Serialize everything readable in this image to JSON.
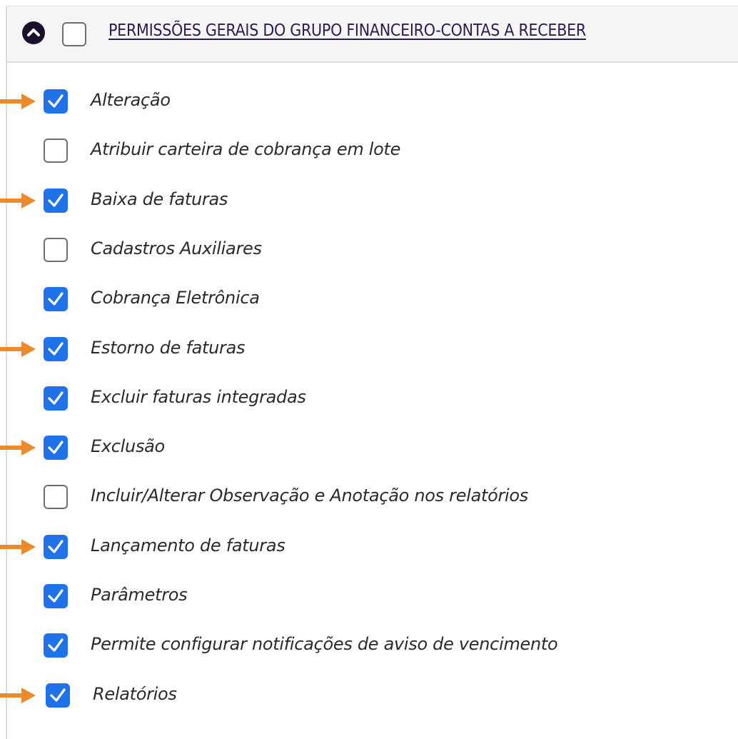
{
  "header": {
    "title": "PERMISSÕES GERAIS DO GRUPO FINANCEIRO-CONTAS A RECEBER",
    "checked": false
  },
  "colors": {
    "checkbox_checked": "#1f73ea",
    "arrow": "#ec8a2c",
    "header_text": "#2d1b4e",
    "collapse_button": "#1c0f2b"
  },
  "permissions": [
    {
      "label": "Alteração",
      "checked": true,
      "highlighted": true
    },
    {
      "label": "Atribuir carteira de cobrança em lote",
      "checked": false,
      "highlighted": false
    },
    {
      "label": "Baixa de faturas",
      "checked": true,
      "highlighted": true
    },
    {
      "label": "Cadastros Auxiliares",
      "checked": false,
      "highlighted": false
    },
    {
      "label": "Cobrança Eletrônica",
      "checked": true,
      "highlighted": false
    },
    {
      "label": "Estorno de faturas",
      "checked": true,
      "highlighted": true
    },
    {
      "label": "Excluir faturas integradas",
      "checked": true,
      "highlighted": false
    },
    {
      "label": "Exclusão",
      "checked": true,
      "highlighted": true
    },
    {
      "label": "Incluir/Alterar Observação e Anotação nos relatórios",
      "checked": false,
      "highlighted": false
    },
    {
      "label": "Lançamento de faturas",
      "checked": true,
      "highlighted": true
    },
    {
      "label": "Parâmetros",
      "checked": true,
      "highlighted": false
    },
    {
      "label": "Permite configurar notificações de aviso de vencimento",
      "checked": true,
      "highlighted": false
    },
    {
      "label": "Relatórios",
      "checked": true,
      "highlighted": true
    }
  ]
}
